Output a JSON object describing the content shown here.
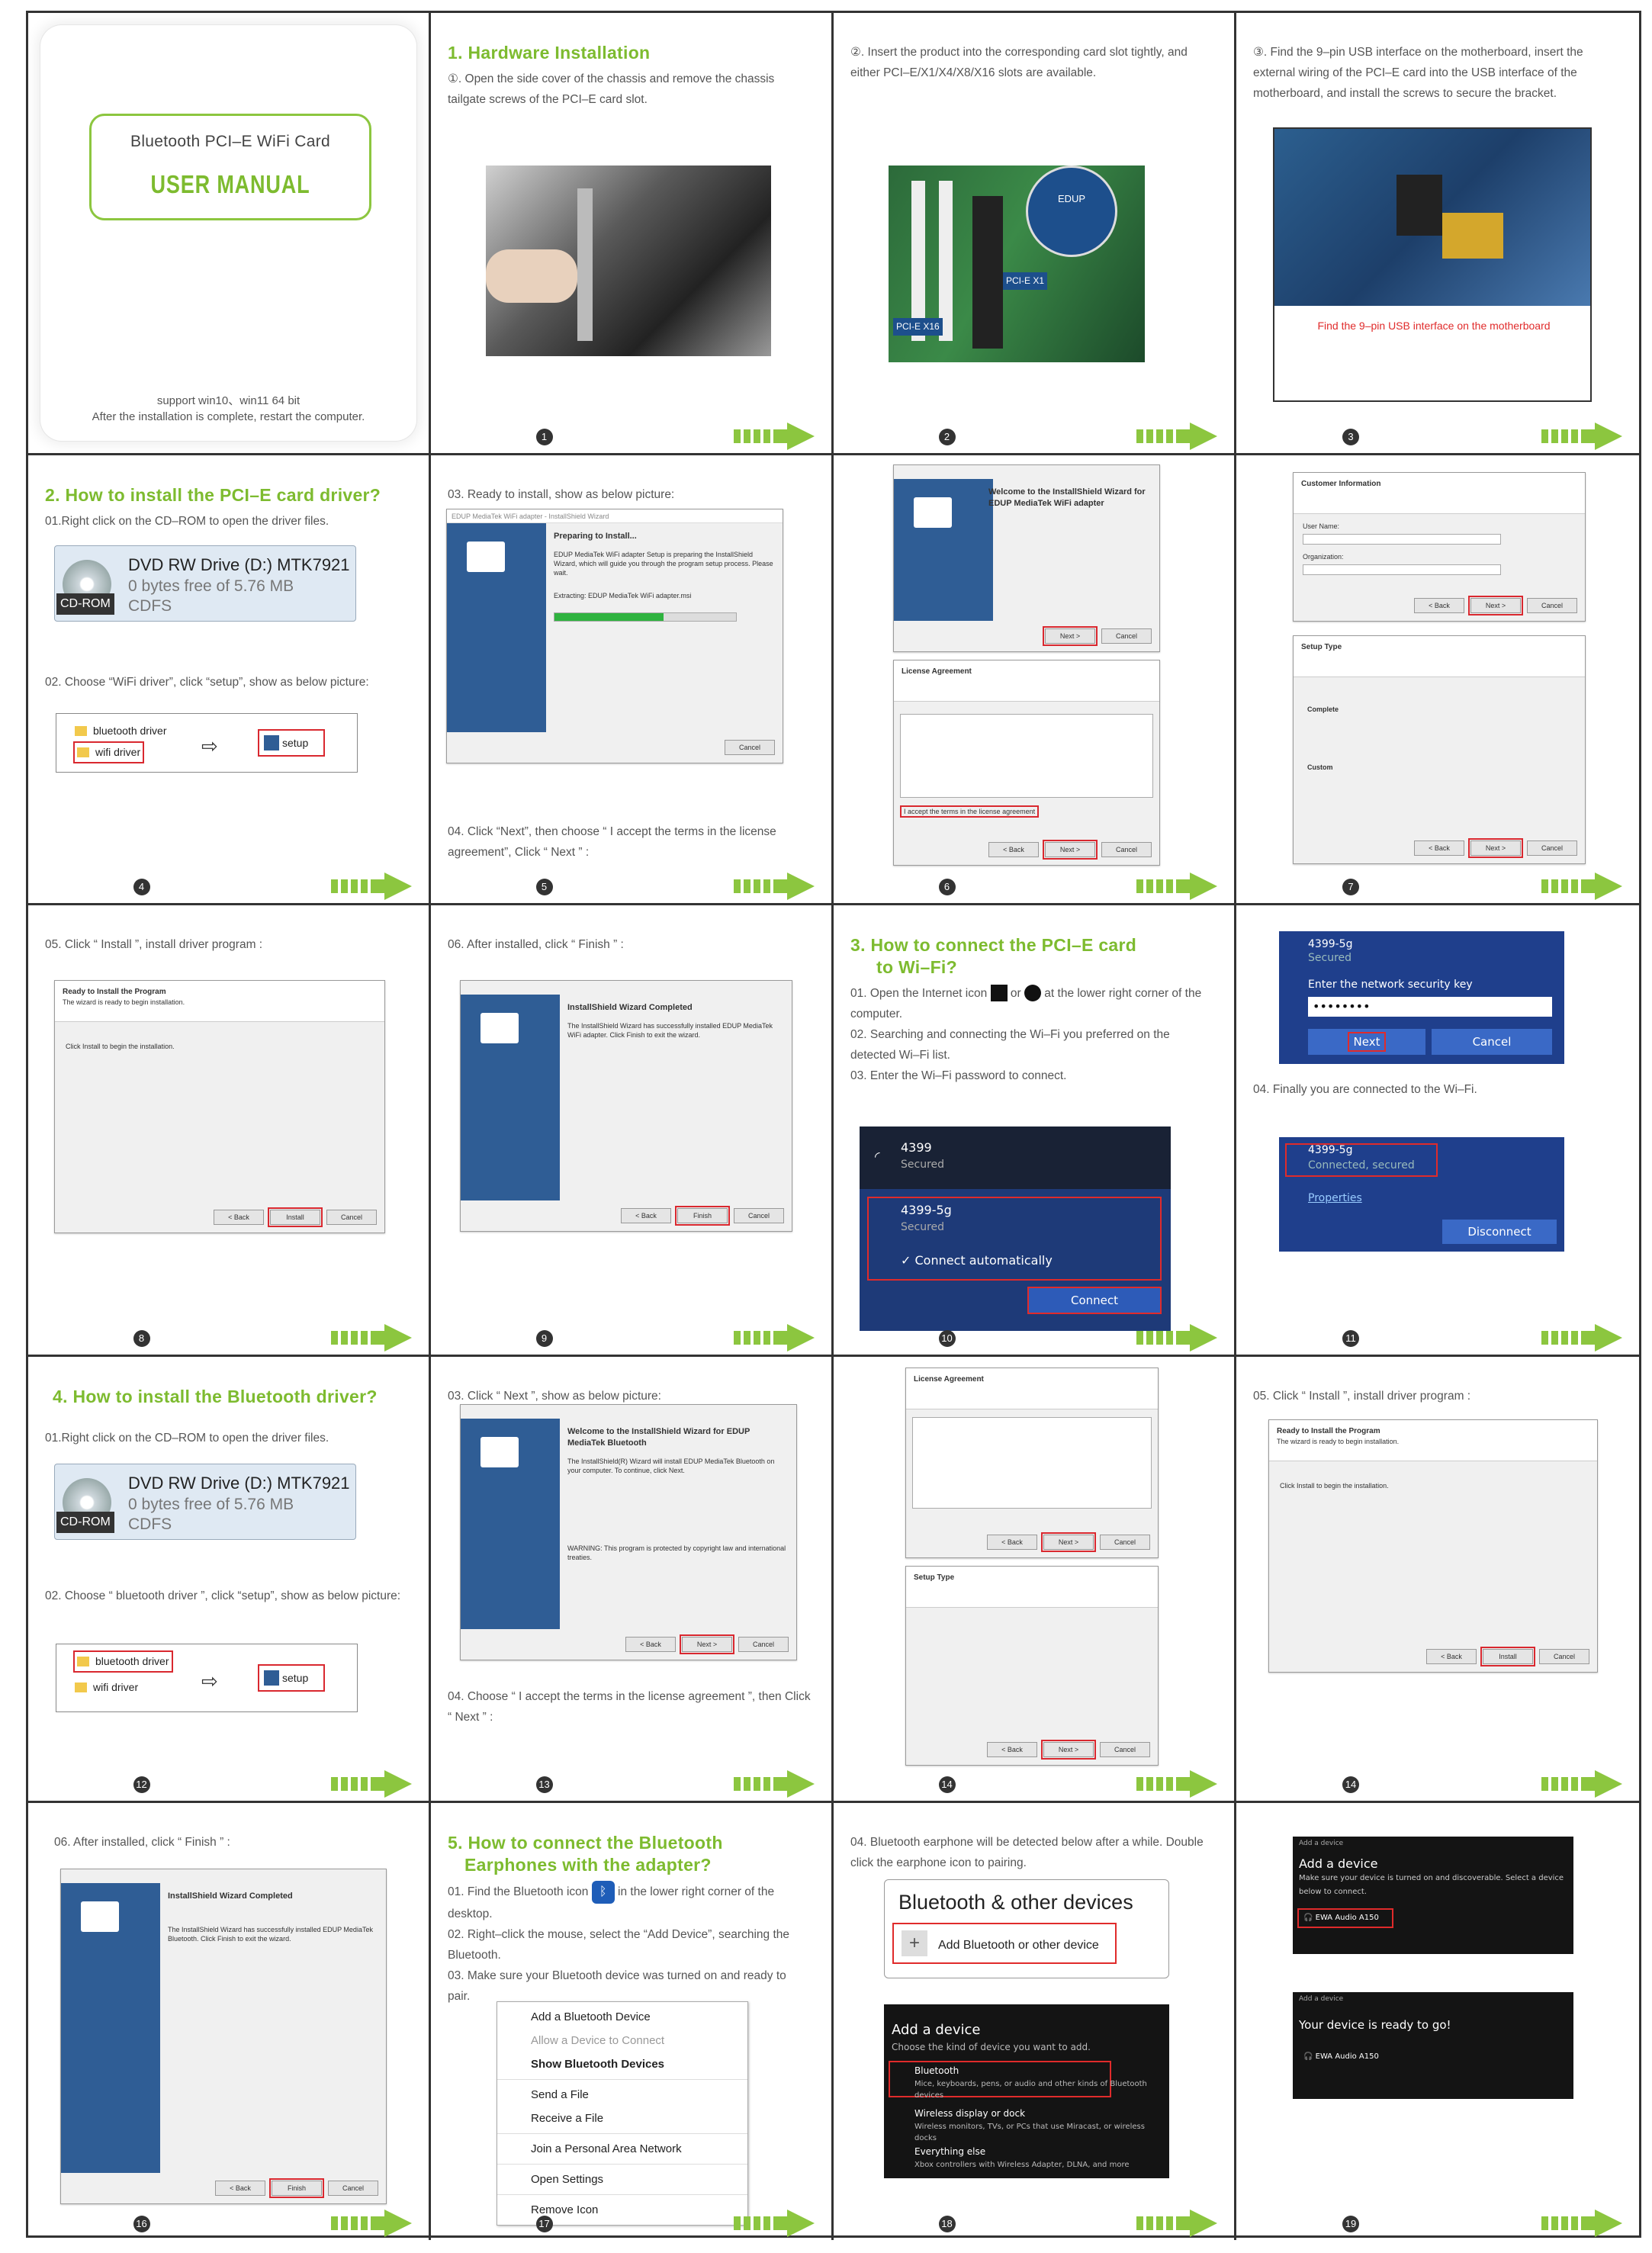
{
  "cover": {
    "subtitle": "Bluetooth PCI–E WiFi Card",
    "title": "USER MANUAL",
    "support": "support win10、win11 64 bit",
    "restart": "After the installation is complete, restart the computer."
  },
  "p1": {
    "heading": "1. Hardware Installation",
    "text": "①. Open the side cover of the chassis and remove the chassis tailgate screws of the PCI–E card slot.",
    "num": "1"
  },
  "p2": {
    "text": "②. Insert the product into the corresponding card slot tightly, and either PCI–E/X1/X4/X8/X16 slots are available.",
    "num": "2",
    "card": "EDUP",
    "slot1": "PCI-E X1",
    "slot16": "PCI-E X16"
  },
  "p3": {
    "text": "③. Find the 9–pin USB interface on the motherboard, insert the external wiring of the PCI–E card into the USB interface of the motherboard, and install the screws to secure the bracket.",
    "caption": "Find the 9–pin USB interface on the motherboard",
    "num": "3"
  },
  "p4": {
    "heading": "2. How to install the PCI–E card driver?",
    "s1": "01.Right click on the CD–ROM to open the driver files.",
    "drive": "DVD RW Drive (D:) MTK7921",
    "free": "0 bytes free of 5.76 MB",
    "cdrom": "CD-ROM",
    "fs": "CDFS",
    "s2": "02. Choose “WiFi driver”, click “setup”, show as below picture:",
    "f1": "bluetooth driver",
    "f2": "wifi driver",
    "setup": "setup",
    "num": "4"
  },
  "p5": {
    "s1": "03. Ready to install, show as below picture:",
    "wtitle": "EDUP MediaTek WiFi adapter - InstallShield Wizard",
    "prep": "Preparing to Install...",
    "body": "EDUP MediaTek WiFi adapter Setup is preparing the InstallShield Wizard, which will guide you through the program setup process. Please wait.",
    "extract": "Extracting: EDUP MediaTek WiFi adapter.msi",
    "cancel": "Cancel",
    "s2": "04. Click “Next”, then choose “ I accept the terms in the license agreement”,  Click “ Next ” :",
    "num": "5"
  },
  "p6": {
    "welcome": "Welcome to the InstallShield Wizard for EDUP MediaTek WiFi adapter",
    "license": "License Agreement",
    "accept": "I accept the terms in the license agreement",
    "next": "Next >",
    "back": "< Back",
    "cancel": "Cancel",
    "num": "6"
  },
  "p7": {
    "cinfo": "Customer Information",
    "user": "User Name:",
    "org": "Organization:",
    "stype": "Setup Type",
    "complete": "Complete",
    "custom": "Custom",
    "next": "Next >",
    "back": "< Back",
    "cancel": "Cancel",
    "num": "7"
  },
  "p8": {
    "s1": "05. Click “ Install ”, install driver program  :",
    "ready": "Ready to Install the Program",
    "sub": "The wizard is ready to begin installation.",
    "body": "Click Install to begin the installation.",
    "install": "Install",
    "back": "< Back",
    "cancel": "Cancel",
    "num": "8"
  },
  "p9": {
    "s1": "06. After installed, click “ Finish ” :",
    "done": "InstallShield Wizard Completed",
    "body": "The InstallShield Wizard has successfully installed EDUP MediaTek WiFi adapter. Click Finish to exit the wizard.",
    "back": "< Back",
    "finish": "Finish",
    "cancel": "Cancel",
    "num": "9"
  },
  "p10": {
    "heading1": "3. How to connect the PCI–E card",
    "heading2": "to Wi–Fi?",
    "s1a": "01. Open the Internet icon",
    "s1or": "or",
    "s1b": "at the lower right corner of the computer.",
    "s2": "02. Searching and connecting the Wi–Fi you preferred on the detected Wi–Fi list.",
    "s3": "03. Enter the Wi–Fi password to connect.",
    "n1": "4399",
    "sec": "Secured",
    "n2": "4399-5g",
    "auto": "Connect automatically",
    "connect": "Connect",
    "num": "10"
  },
  "p11": {
    "net": "4399-5g",
    "sec": "Secured",
    "key": "Enter the network security key",
    "pass": "••••••••",
    "next": "Next",
    "cancel": "Cancel",
    "s4": "04. Finally you are connected to the Wi–Fi.",
    "connected": "Connected, secured",
    "props": "Properties",
    "disc": "Disconnect",
    "num": "11"
  },
  "p12": {
    "heading": "4. How to install the Bluetooth driver?",
    "s1": "01.Right click on the CD–ROM to open the driver files.",
    "drive": "DVD RW Drive (D:) MTK7921",
    "free": "0 bytes free of 5.76 MB",
    "cdrom": "CD-ROM",
    "fs": "CDFS",
    "s2": "02.   Choose “ bluetooth driver ”, click “setup”, show as below picture:",
    "f1": "bluetooth driver",
    "f2": "wifi driver",
    "setup": "setup",
    "num": "12"
  },
  "p13": {
    "s1": "03. Click “ Next ”, show as below picture:",
    "welcome": "Welcome to the InstallShield Wizard for EDUP MediaTek Bluetooth",
    "body": "The InstallShield(R) Wizard will install EDUP MediaTek Bluetooth on your computer. To continue, click Next.",
    "warn": "WARNING: This program is protected by copyright law and international treaties.",
    "back": "< Back",
    "next": "Next >",
    "cancel": "Cancel",
    "s2": "04.  Choose “ I accept the terms in the license agreement ”, then Click “ Next ” :",
    "num": "13"
  },
  "p14": {
    "license": "License Agreement",
    "stype": "Setup Type",
    "next": "Next >",
    "back": "< Back",
    "cancel": "Cancel",
    "num": "14"
  },
  "p15": {
    "s1": "05. Click “ Install ”, install driver program :",
    "ready": "Ready to Install the Program",
    "sub": "The wizard is ready to begin installation.",
    "body": "Click Install to begin the installation.",
    "install": "Install",
    "back": "< Back",
    "cancel": "Cancel",
    "num": "14"
  },
  "p16": {
    "s1": "06. After installed, click “ Finish ” :",
    "done": "InstallShield Wizard Completed",
    "body": "The InstallShield Wizard has successfully installed EDUP MediaTek Bluetooth. Click Finish to exit the wizard.",
    "back": "< Back",
    "finish": "Finish",
    "cancel": "Cancel",
    "num": "16"
  },
  "p17": {
    "heading1": "5. How to connect the Bluetooth",
    "heading2": "Earphones with the adapter?",
    "s1a": "01. Find the Bluetooth icon",
    "s1b": "in the lower right corner of the desktop.",
    "s2": "02. Right–click the mouse, select the “Add Device”, searching the Bluetooth.",
    "s3": "03.  Make sure your Bluetooth device was turned on and ready to pair.",
    "menu": [
      "Add a Bluetooth Device",
      "Allow a Device to Connect",
      "Show Bluetooth Devices",
      "Send a File",
      "Receive a File",
      "Join a Personal Area Network",
      "Open Settings",
      "Remove Icon"
    ],
    "num": "17"
  },
  "p18": {
    "s1": "04. Bluetooth earphone will be detected below after a while. Double click the earphone icon to pairing.",
    "bt": "Bluetooth & other devices",
    "add": "Add Bluetooth or other device",
    "dtitle": "Add a device",
    "dsub": "Choose the kind of device you want to add.",
    "o1": "Bluetooth",
    "o1d": "Mice, keyboards, pens, or audio and other kinds of Bluetooth devices",
    "o2": "Wireless display or dock",
    "o2d": "Wireless monitors, TVs, or PCs that use Miracast, or wireless docks",
    "o3": "Everything else",
    "o3d": "Xbox controllers with Wireless Adapter, DLNA, and more",
    "num": "18"
  },
  "p19": {
    "cap": "Add a device",
    "title": "Add a device",
    "msg": "Make sure your device is turned on and discoverable. Select a device below to connect.",
    "dev": "EWA Audio A150",
    "ready": "Your device is ready to go!",
    "num": "19"
  }
}
